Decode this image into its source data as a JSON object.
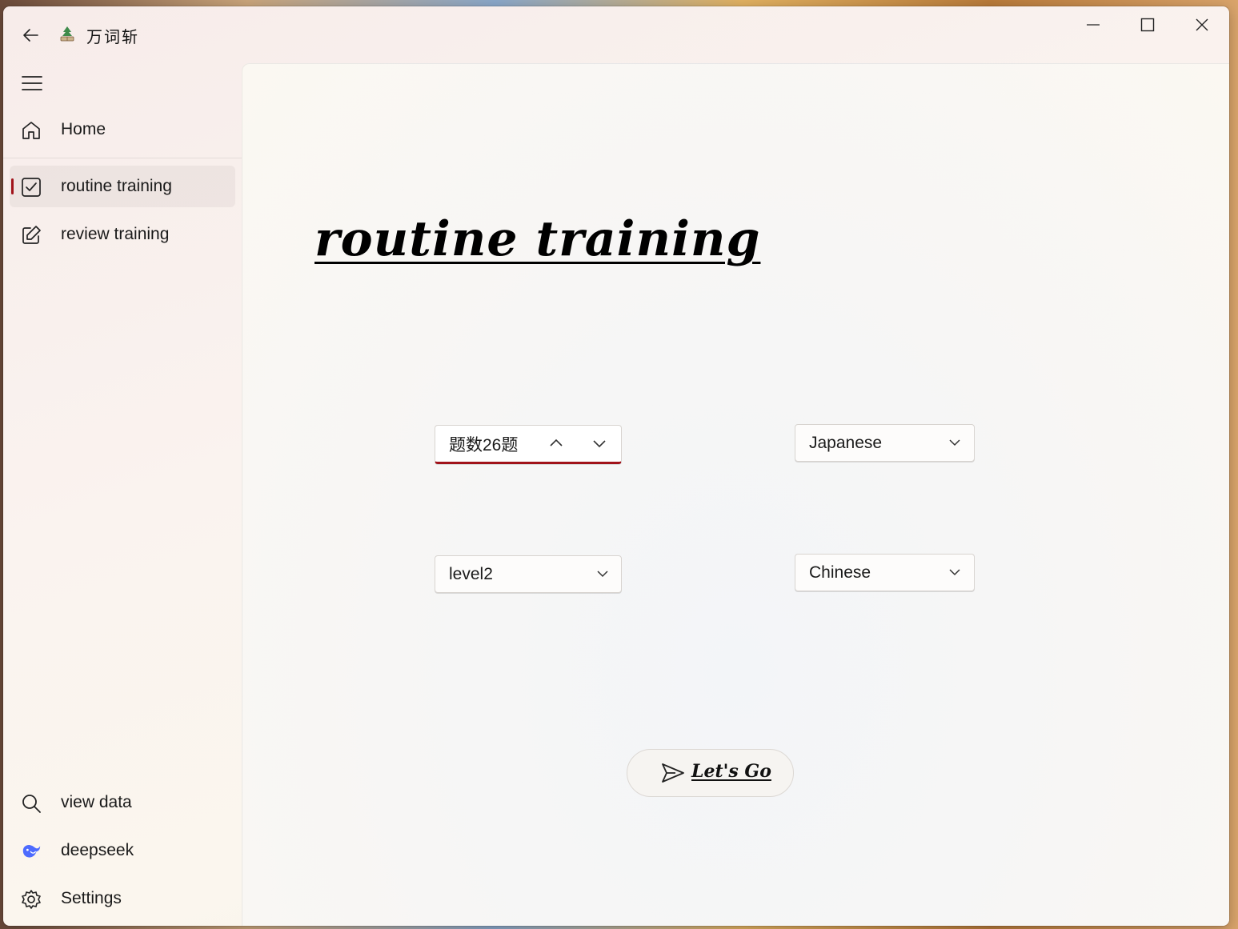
{
  "app": {
    "title": "万词斩"
  },
  "nav": {
    "items": [
      {
        "label": "Home",
        "icon": "home-icon"
      },
      {
        "label": "routine training",
        "icon": "checkbox-icon",
        "selected": true
      },
      {
        "label": "review training",
        "icon": "edit-icon"
      }
    ],
    "footer_items": [
      {
        "label": "view data",
        "icon": "search-icon"
      },
      {
        "label": "deepseek",
        "icon": "deepseek-whale-icon"
      },
      {
        "label": "Settings",
        "icon": "gear-icon"
      }
    ]
  },
  "main": {
    "heading": "routine training",
    "question_count": {
      "value": "题数26题"
    },
    "level_select": {
      "value": "level2"
    },
    "source_language": {
      "value": "Japanese"
    },
    "target_language": {
      "value": "Chinese"
    },
    "go_button": {
      "label": "Let's Go"
    }
  },
  "colors": {
    "accent": "#a1131a",
    "deepseek": "#4d6bfe"
  }
}
